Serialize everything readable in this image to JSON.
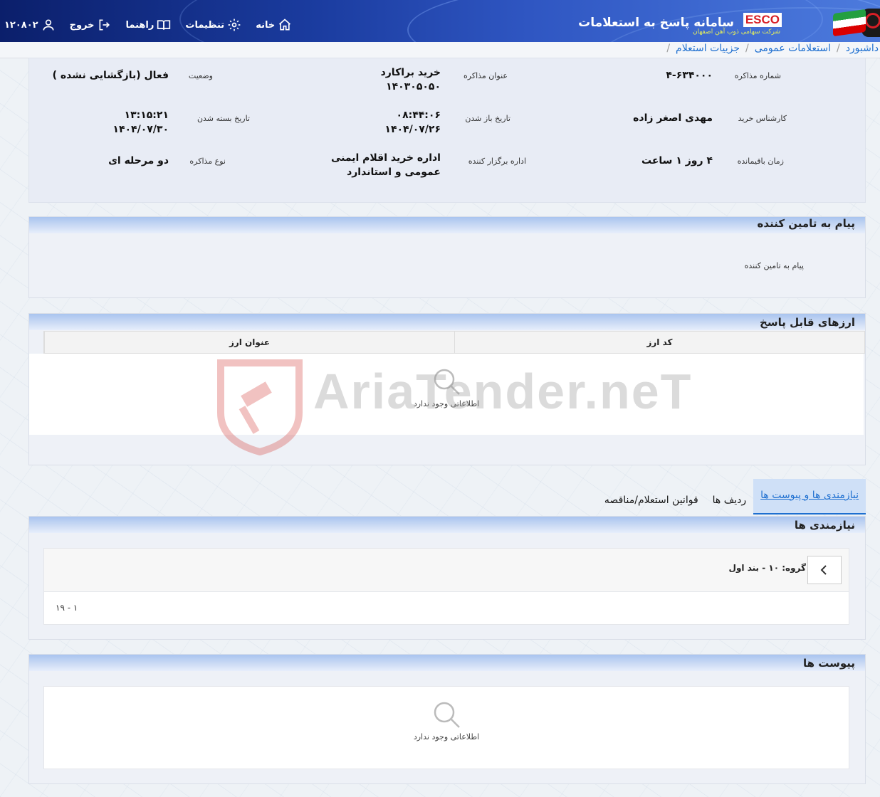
{
  "header": {
    "system_title": "سامانه پاسخ به استعلامات",
    "logo_brand": "ESCO",
    "logo_subtitle": "شرکت سهامی ذوب آهن اصفهان",
    "nav": {
      "home": "خانه",
      "settings": "تنظیمات",
      "guide": "راهنما",
      "logout": "خروج",
      "user_id": "۱۲۰۸۰۲"
    }
  },
  "breadcrumb": [
    "داشبورد",
    "استعلامات عمومی",
    "جزییات استعلام"
  ],
  "details": {
    "negotiation_number_label": "شماره مذاکره",
    "negotiation_number": "۴-۶۳۴۰۰۰",
    "title_label": "عنوان مذاکره",
    "title_value_1": "خرید براکارد",
    "title_value_2": "۱۴۰۳۰۵۰۵۰",
    "status_label": "وضعیت",
    "status_value": "فعال (بازگشایی نشده )",
    "buyer_label": "کارشناس خرید",
    "buyer_value": "مهدی اصغر زاده",
    "open_date_label": "تاریخ باز شدن",
    "open_time": "۰۸:۴۴:۰۶",
    "open_date": "۱۴۰۴/۰۷/۲۶",
    "close_date_label": "تاریخ بسته شدن",
    "close_time": "۱۳:۱۵:۲۱",
    "close_date": "۱۴۰۴/۰۷/۳۰",
    "remaining_label": "زمان باقیمانده",
    "remaining_value": "۴ روز ۱ ساعت",
    "organizer_label": "اداره برگزار کننده",
    "organizer_value_1": "اداره خرید اقلام ایمنی",
    "organizer_value_2": "عمومی و استاندارد",
    "type_label": "نوع مذاکره",
    "type_value": "دو مرحله ای"
  },
  "supplier_message": {
    "panel_title": "پیام به تامین کننده",
    "field_label": "پیام به تامین کننده"
  },
  "currencies": {
    "panel_title": "ارزهای قابل پاسخ",
    "col_code": "کد ارز",
    "col_title": "عنوان ارز",
    "empty": "اطلاعاتی وجود ندارد"
  },
  "tabs": [
    "نیازمندی ها و پیوست ها",
    "ردیف ها",
    "قوانین استعلام/مناقصه"
  ],
  "requirements": {
    "panel_title": "نیازمندی ها",
    "group_label": "گروه: ۱۰ - بند اول",
    "range": "۱ - ۱۹"
  },
  "attachments": {
    "panel_title": "پیوست ها",
    "empty": "اطلاعاتی وجود ندارد"
  },
  "watermark": "AriaTender.neT"
}
